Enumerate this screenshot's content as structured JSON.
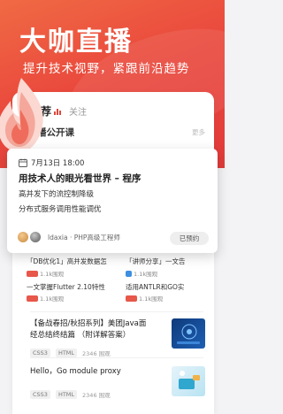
{
  "hero": {
    "title": "大咖直播",
    "subtitle": "提升技术视野，紧跟前沿趋势"
  },
  "tabs": {
    "recommended": "推荐",
    "follow": "关注"
  },
  "section": {
    "title": "播公开课",
    "more": "更多"
  },
  "popup": {
    "date": "7月13日 18:00",
    "title": "用技术人的眼光看世界 – 程序",
    "line1": "高并发下的流控制降级",
    "line2": "分布式服务调用性能调优",
    "author": "ldaxia · PHP高级工程师",
    "button": "已预约"
  },
  "grid": {
    "c1_title": "「DB优化1」高并发数据怎",
    "c1_views": "1.1k围观",
    "c2_title": "「讲师分享」一文告",
    "c2_views": "1.1k围观",
    "c3_title": "一文掌握Flutter 2.10特性",
    "c3_views": "1.1k围观",
    "c4_title": "适用ANTLR和GO实",
    "c4_views": "1.1k围观"
  },
  "list": [
    {
      "title": "【备战春招/秋招系列】美团Java面经总结终结篇 （附详解答案）",
      "tag1": "CSS3",
      "tag2": "HTML",
      "views": "2346 围观"
    },
    {
      "title": "Hello，Go module proxy",
      "tag1": "CSS3",
      "tag2": "HTML",
      "views": "2346 围观"
    }
  ],
  "colors": {
    "brand_red": "#e2463b",
    "hero_start": "#f06a44",
    "hero_end": "#e23b3b"
  },
  "icons": [
    "flame-logo-icon",
    "bars-icon",
    "calendar-icon",
    "views-badge-icon"
  ]
}
